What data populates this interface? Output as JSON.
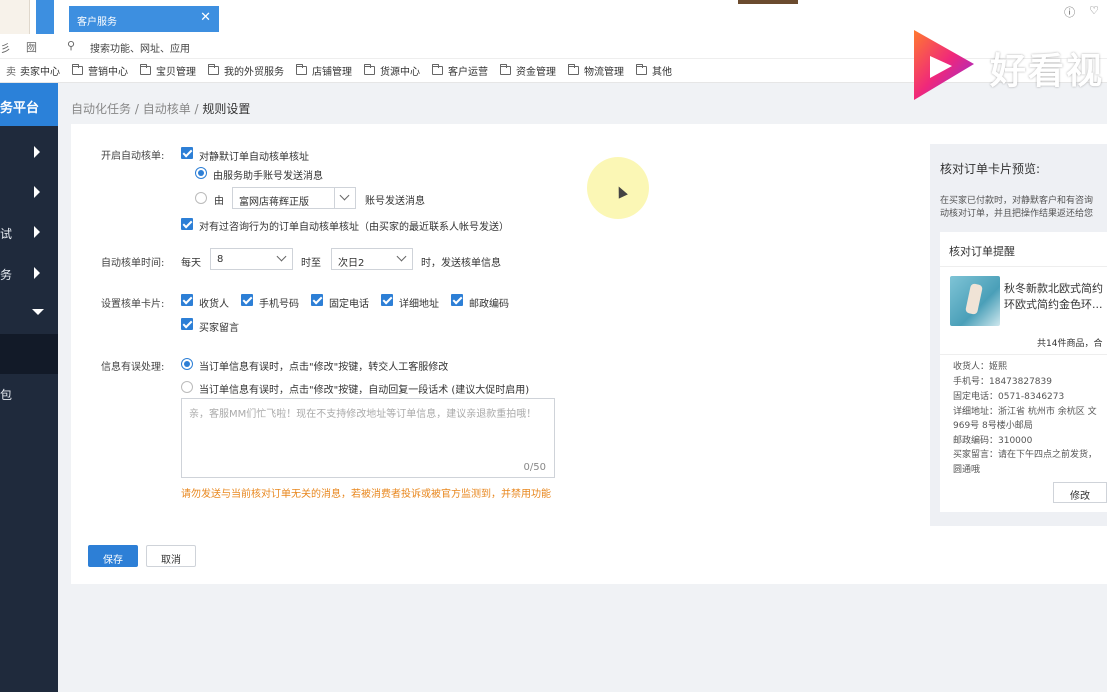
{
  "tabs": {
    "active_label": "客户服务",
    "close_glyph": "✕"
  },
  "top_icons": [
    "help-icon",
    "settings-icon"
  ],
  "addressbar": {
    "left_icon_1": "彡",
    "left_icon_2": "囫",
    "search_placeholder": "搜索功能、网址、应用"
  },
  "bookmarks": {
    "first": "卖家中心",
    "items": [
      "营销中心",
      "宝贝管理",
      "我的外贸服务",
      "店铺管理",
      "货源中心",
      "客户运营",
      "资金管理",
      "物流管理",
      "其他"
    ]
  },
  "sidebar": {
    "header": "务平台",
    "items": [
      {
        "label": ""
      },
      {
        "label": ""
      },
      {
        "label": "试"
      },
      {
        "label": "务"
      },
      {
        "label": ""
      },
      {
        "label": ""
      },
      {
        "label": "包"
      }
    ]
  },
  "breadcrumb": {
    "part1": "自动化任务",
    "sep": " / ",
    "part2": "自动核单",
    "part3": "规则设置"
  },
  "form": {
    "auto_check": {
      "label": "开启自动核单:",
      "silent_order": "对静默订单自动核单核址",
      "send_by_assistant": "由服务助手账号发送消息",
      "send_by_prefix": "由",
      "account_select": "富网店蒋辉正版",
      "send_by_suffix": "账号发送消息",
      "consulted_order": "对有过咨询行为的订单自动核单核址（由买家的最近联系人帐号发送）"
    },
    "time": {
      "label": "自动核单时间:",
      "every_day": "每天",
      "start_hour": "8",
      "to_label": "时至",
      "end_day": "次日2",
      "suffix": "时，发送核单信息"
    },
    "card": {
      "label": "设置核单卡片:",
      "fields": [
        "收货人",
        "手机号码",
        "固定电话",
        "详细地址",
        "邮政编码",
        "买家留言"
      ]
    },
    "error": {
      "label": "信息有误处理:",
      "option1": "当订单信息有误时，点击\"修改\"按键，转交人工客服修改",
      "option2": "当订单信息有误时，点击\"修改\"按键，自动回复一段话术 (建议大促时启用)",
      "textarea_placeholder": "亲，客服MM们忙飞啦！现在不支持修改地址等订单信息，建议亲退款重拍哦！",
      "char_count": "0/50",
      "warning": "请勿发送与当前核对订单无关的消息，若被消费者投诉或被官方监测到，并禁用功能"
    },
    "save": "保存",
    "cancel": "取消"
  },
  "preview": {
    "title": "核对订单卡片预览:",
    "desc_line1": "在买家已付款时，对静默客户和有咨询",
    "desc_line2": "动核对订单，并且把操作结果返还给您",
    "card_title": "核对订单提醒",
    "product_line1": "秋冬新款北欧式简约",
    "product_line2": "环欧式简约金色环...",
    "total": "共14件商品，合",
    "receiver": "收货人：姬熙",
    "phone": "手机号：18473827839",
    "landline": "固定电话：0571-8346273",
    "address_line1": "详细地址：浙江省 杭州市 余杭区 文",
    "address_line2": "969号 8号楼小邮局",
    "postcode": "邮政编码：310000",
    "message_line1": "买家留言：请在下午四点之前发货，",
    "message_line2": "圆通哦",
    "edit_button": "修改"
  },
  "watermark": {
    "text": "好看视"
  },
  "colors": {
    "primary": "#2d7fd6",
    "sidebar": "#1f2a3c",
    "sidebar_header": "#2b81d9",
    "warning": "#e8871e"
  }
}
